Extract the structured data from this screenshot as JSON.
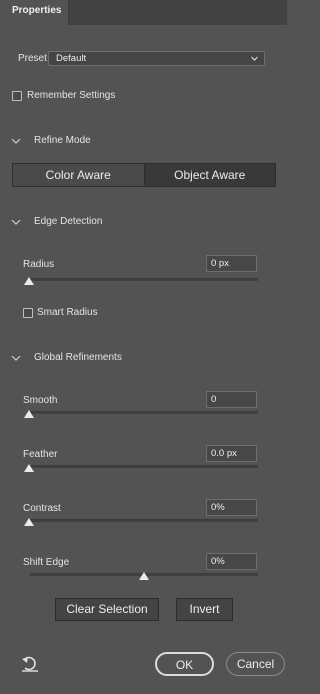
{
  "panel": {
    "tab_label": "Properties"
  },
  "preset": {
    "label": "Preset",
    "value": "Default"
  },
  "remember_settings": {
    "label": "Remember Settings",
    "checked": false
  },
  "refine_mode": {
    "heading": "Refine Mode",
    "options": [
      "Color Aware",
      "Object Aware"
    ],
    "selected": "Object Aware"
  },
  "edge_detection": {
    "heading": "Edge Detection",
    "radius": {
      "label": "Radius",
      "value": "0 px",
      "level": 0
    },
    "smart_radius": {
      "label": "Smart Radius",
      "checked": false
    }
  },
  "global_refinements": {
    "heading": "Global Refinements",
    "smooth": {
      "label": "Smooth",
      "value": "0",
      "level": 0
    },
    "feather": {
      "label": "Feather",
      "value": "0.0 px",
      "level": 0
    },
    "contrast": {
      "label": "Contrast",
      "value": "0%",
      "level": 0
    },
    "shift_edge": {
      "label": "Shift Edge",
      "value": "0%",
      "level": 0.5
    }
  },
  "actions": {
    "clear_selection": "Clear Selection",
    "invert": "Invert"
  },
  "footer": {
    "ok": "OK",
    "cancel": "Cancel",
    "reset_icon": "reset-icon"
  },
  "colors": {
    "panel_bg": "#535353",
    "field_bg": "#474747",
    "selected_segment": "#393939",
    "text": "#e4e4e4"
  }
}
